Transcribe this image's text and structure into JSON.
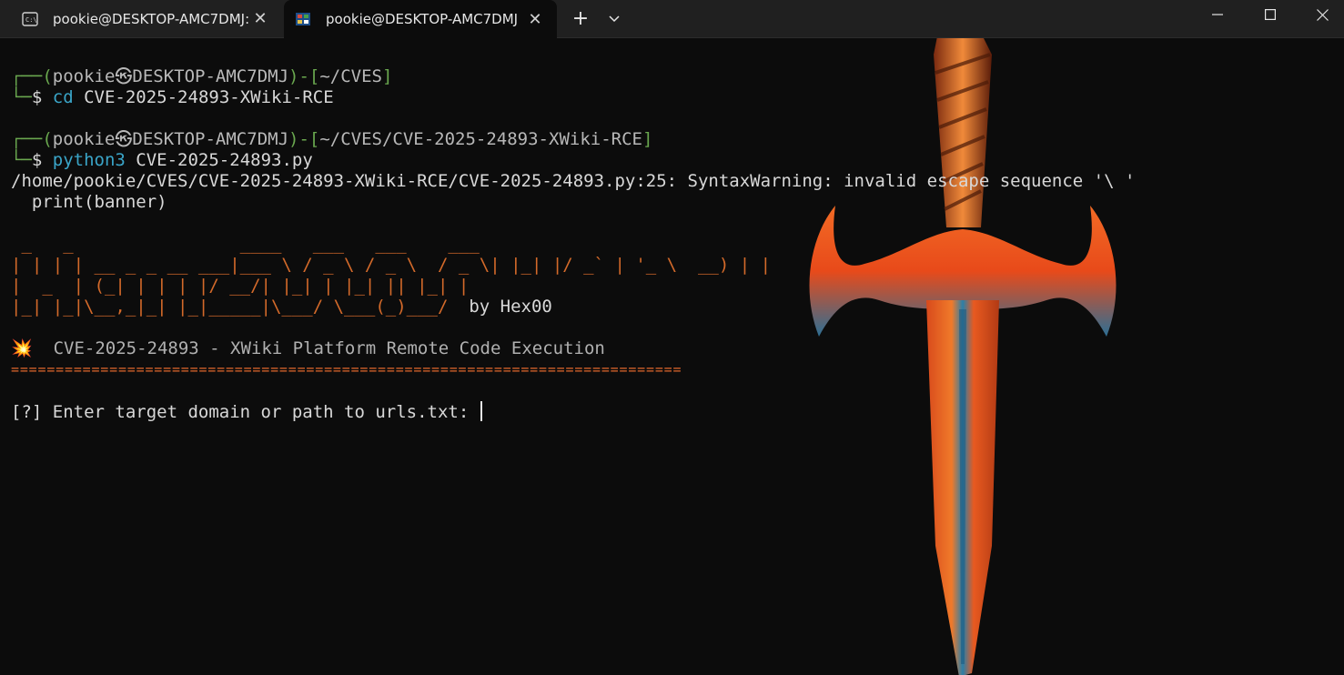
{
  "tabs": [
    {
      "title": "pookie@DESKTOP-AMC7DMJ:",
      "icon": "terminal-icon",
      "active": false
    },
    {
      "title": "pookie@DESKTOP-AMC7DMJ",
      "icon": "kali-icon",
      "active": true
    }
  ],
  "new_tab_label": "+",
  "window_controls": [
    "minimize",
    "maximize",
    "close"
  ],
  "terminal": {
    "block1": {
      "prompt_open": "┌──(",
      "user": "pookie",
      "host_sep": "㉿",
      "host": "DESKTOP-AMC7DMJ",
      "mid": ")-[",
      "path": "~/CVES",
      "close": "]",
      "line2_prefix": "└─",
      "dollar": "$ ",
      "cmd": "cd",
      "args": " CVE-2025-24893-XWiki-RCE"
    },
    "block2": {
      "prompt_open": "┌──(",
      "user": "pookie",
      "host_sep": "㉿",
      "host": "DESKTOP-AMC7DMJ",
      "mid": ")-[",
      "path": "~/CVES/CVE-2025-24893-XWiki-RCE",
      "close": "]",
      "line2_prefix": "└─",
      "dollar": "$ ",
      "cmd": "python3",
      "args": " CVE-2025-24893.py"
    },
    "warning_line": "/home/pookie/CVES/CVE-2025-24893-XWiki-RCE/CVE-2025-24893.py:25: SyntaxWarning: invalid escape sequence '\\ '",
    "warning_code": "  print(banner)",
    "ascii_banner": [
      " _   _                ____   ___   ___    ___ ",
      "| | | | __ _ _ __ ___|___ \\ / _ \\ / _ \\  / _ \\| |_| |/ _` | '_ \\  __) | |",
      "|  _  | (_| | | | |/ __/| |_| | |_| || |_| |",
      "|_| |_|\\__,_|_| |_|_____|\\___/ \\___(_)___/ "
    ],
    "byline": " by Hex00",
    "title_icon": "💥",
    "title": "CVE-2025-24893 - XWiki Platform Remote Code Execution",
    "separator": "===========================================================================",
    "input_prompt": "[?] Enter target domain or path to urls.txt: "
  }
}
